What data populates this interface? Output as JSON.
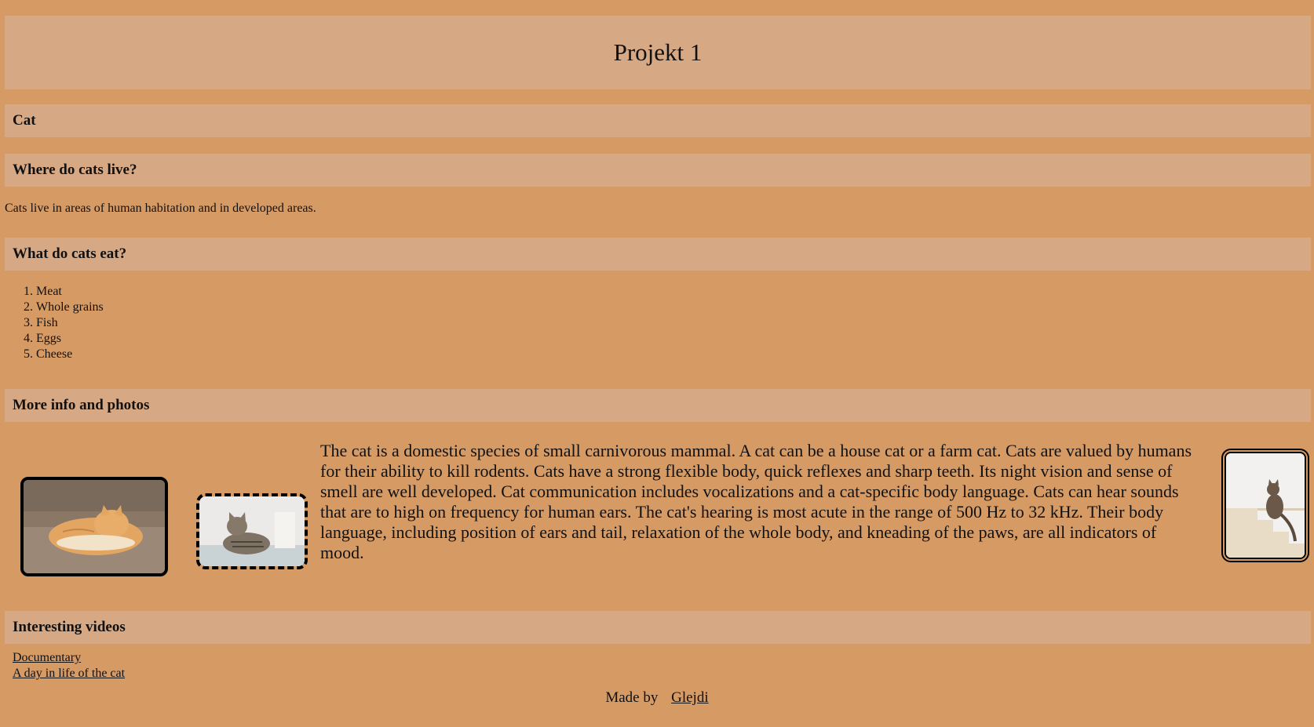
{
  "page": {
    "title": "Projekt 1"
  },
  "sections": {
    "cat_heading": "Cat",
    "where_heading": "Where do cats live?",
    "where_text": "Cats live in areas of human habitation and in developed areas.",
    "eat_heading": "What do cats eat?",
    "eat_items": [
      "Meat",
      "Whole grains",
      "Fish",
      "Eggs",
      "Cheese"
    ],
    "info_heading": "More info and photos",
    "info_text": "The cat is a domestic species of small carnivorous mammal. A cat can be a house cat or a farm cat. Cats are valued by humans for their ability to kill rodents. Cats have a strong flexible body, quick reflexes and sharp teeth. Its night vision and sense of smell are well developed. Cat communication includes vocalizations and a cat-specific body language. Cats can hear sounds that are to high on frequency for human ears. The cat's hearing is most acute in the range of 500 Hz to 32 kHz. Their body language, including position of ears and tail, relaxation of the whole body, and kneading of the paws, are all indicators of mood.",
    "videos_heading": "Interesting videos",
    "video_links": [
      "Documentary",
      "A day in life of the cat"
    ]
  },
  "footer": {
    "made_by": "Made by",
    "author": "Glejdi"
  },
  "colors": {
    "background": "#d69a65",
    "bar": "#d6a884"
  }
}
